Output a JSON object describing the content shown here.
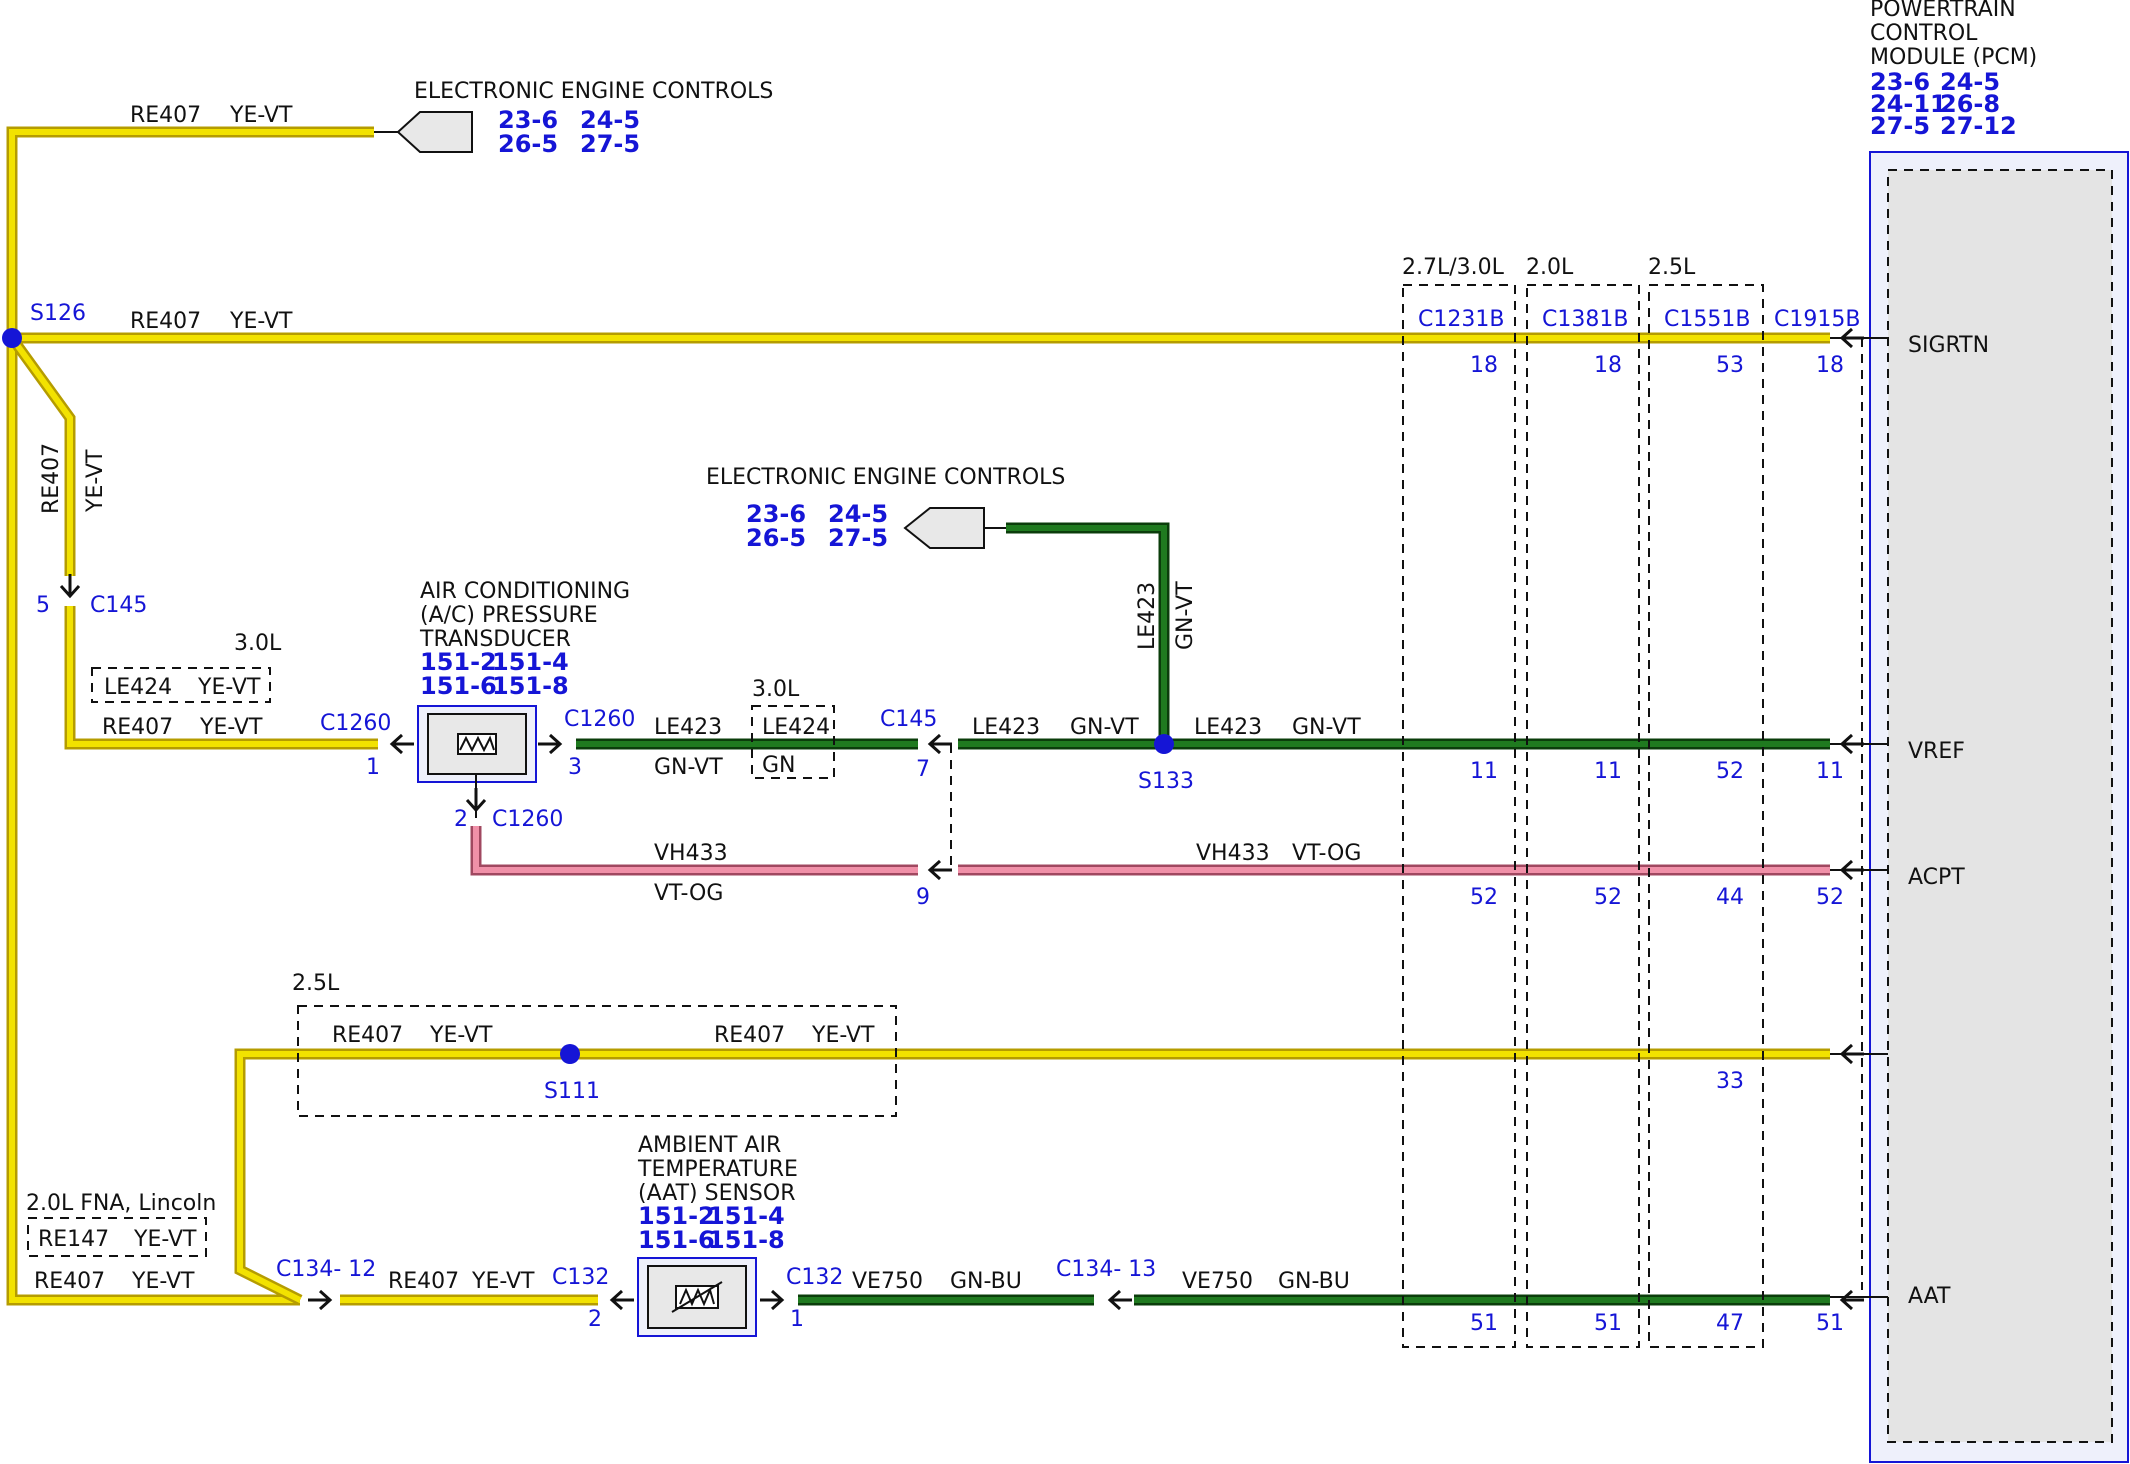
{
  "colors": {
    "yellow": "#f2e200",
    "yellow_edge": "#b59c00",
    "green": "#1f7a1f",
    "green_edge": "#0b3d0b",
    "pink": "#f090a8",
    "pink_edge": "#a04860",
    "blue": "#1515d6",
    "black": "#111111"
  },
  "eec_top": {
    "title": "ELECTRONIC ENGINE CONTROLS",
    "refs": [
      "23-6",
      "24-5",
      "26-5",
      "27-5"
    ]
  },
  "eec_mid": {
    "title": "ELECTRONIC ENGINE CONTROLS",
    "refs": [
      "23-6",
      "24-5",
      "26-5",
      "27-5"
    ]
  },
  "pcm": {
    "title": [
      "POWERTRAIN",
      "CONTROL",
      "MODULE (PCM)"
    ],
    "refs": [
      "23-6",
      "24-5",
      "24-11",
      "26-8",
      "27-5",
      "27-12"
    ],
    "pins": [
      "SIGRTN",
      "VREF",
      "ACPT",
      "AAT"
    ]
  },
  "ac_sensor": {
    "title": [
      "AIR CONDITIONING",
      "(A/C) PRESSURE",
      "TRANSDUCER"
    ],
    "refs": [
      "151-2",
      "151-4",
      "151-6",
      "151-8"
    ]
  },
  "aat_sensor": {
    "title": [
      "AMBIENT AIR",
      "TEMPERATURE",
      "(AAT) SENSOR"
    ],
    "refs": [
      "151-2",
      "151-4",
      "151-6",
      "151-8"
    ]
  },
  "splices": [
    "S126",
    "S133",
    "S111"
  ],
  "engine_boxes": [
    {
      "label": "2.7L/3.0L",
      "connector": "C1231B",
      "pins": [
        "18",
        "11",
        "52",
        "51"
      ]
    },
    {
      "label": "2.0L",
      "connector": "C1381B",
      "pins": [
        "18",
        "11",
        "52",
        "51"
      ]
    },
    {
      "label": "2.5L",
      "connector": "C1551B",
      "pins": [
        "53",
        "52",
        "44",
        "33",
        "47"
      ]
    }
  ],
  "pcm_connector": {
    "label": "C1915B",
    "pins": [
      "18",
      "11",
      "52",
      "51"
    ]
  },
  "wires": {
    "re407": "RE407",
    "ye_vt": "YE-VT",
    "le423": "LE423",
    "gn_vt": "GN-VT",
    "le424": "LE424",
    "gn": "GN",
    "vh433": "VH433",
    "vt_og": "VT-OG",
    "ve750": "VE750",
    "gn_bu": "GN-BU",
    "re147": "RE147"
  },
  "variants": {
    "v30": "3.0L",
    "v25": "2.5L",
    "v20_fna": "2.0L FNA, Lincoln"
  },
  "connectors": {
    "c145": "C145",
    "c1260": "C1260",
    "c132": "C132",
    "c134_12": "C134- 12",
    "c134_13": "C134- 13"
  },
  "pins": {
    "c145_top": "5",
    "c1260_1": "1",
    "c1260_3": "3",
    "c1260_2": "2",
    "c145_7": "7",
    "c145_9": "9",
    "c132_2": "2",
    "c132_1": "1"
  }
}
